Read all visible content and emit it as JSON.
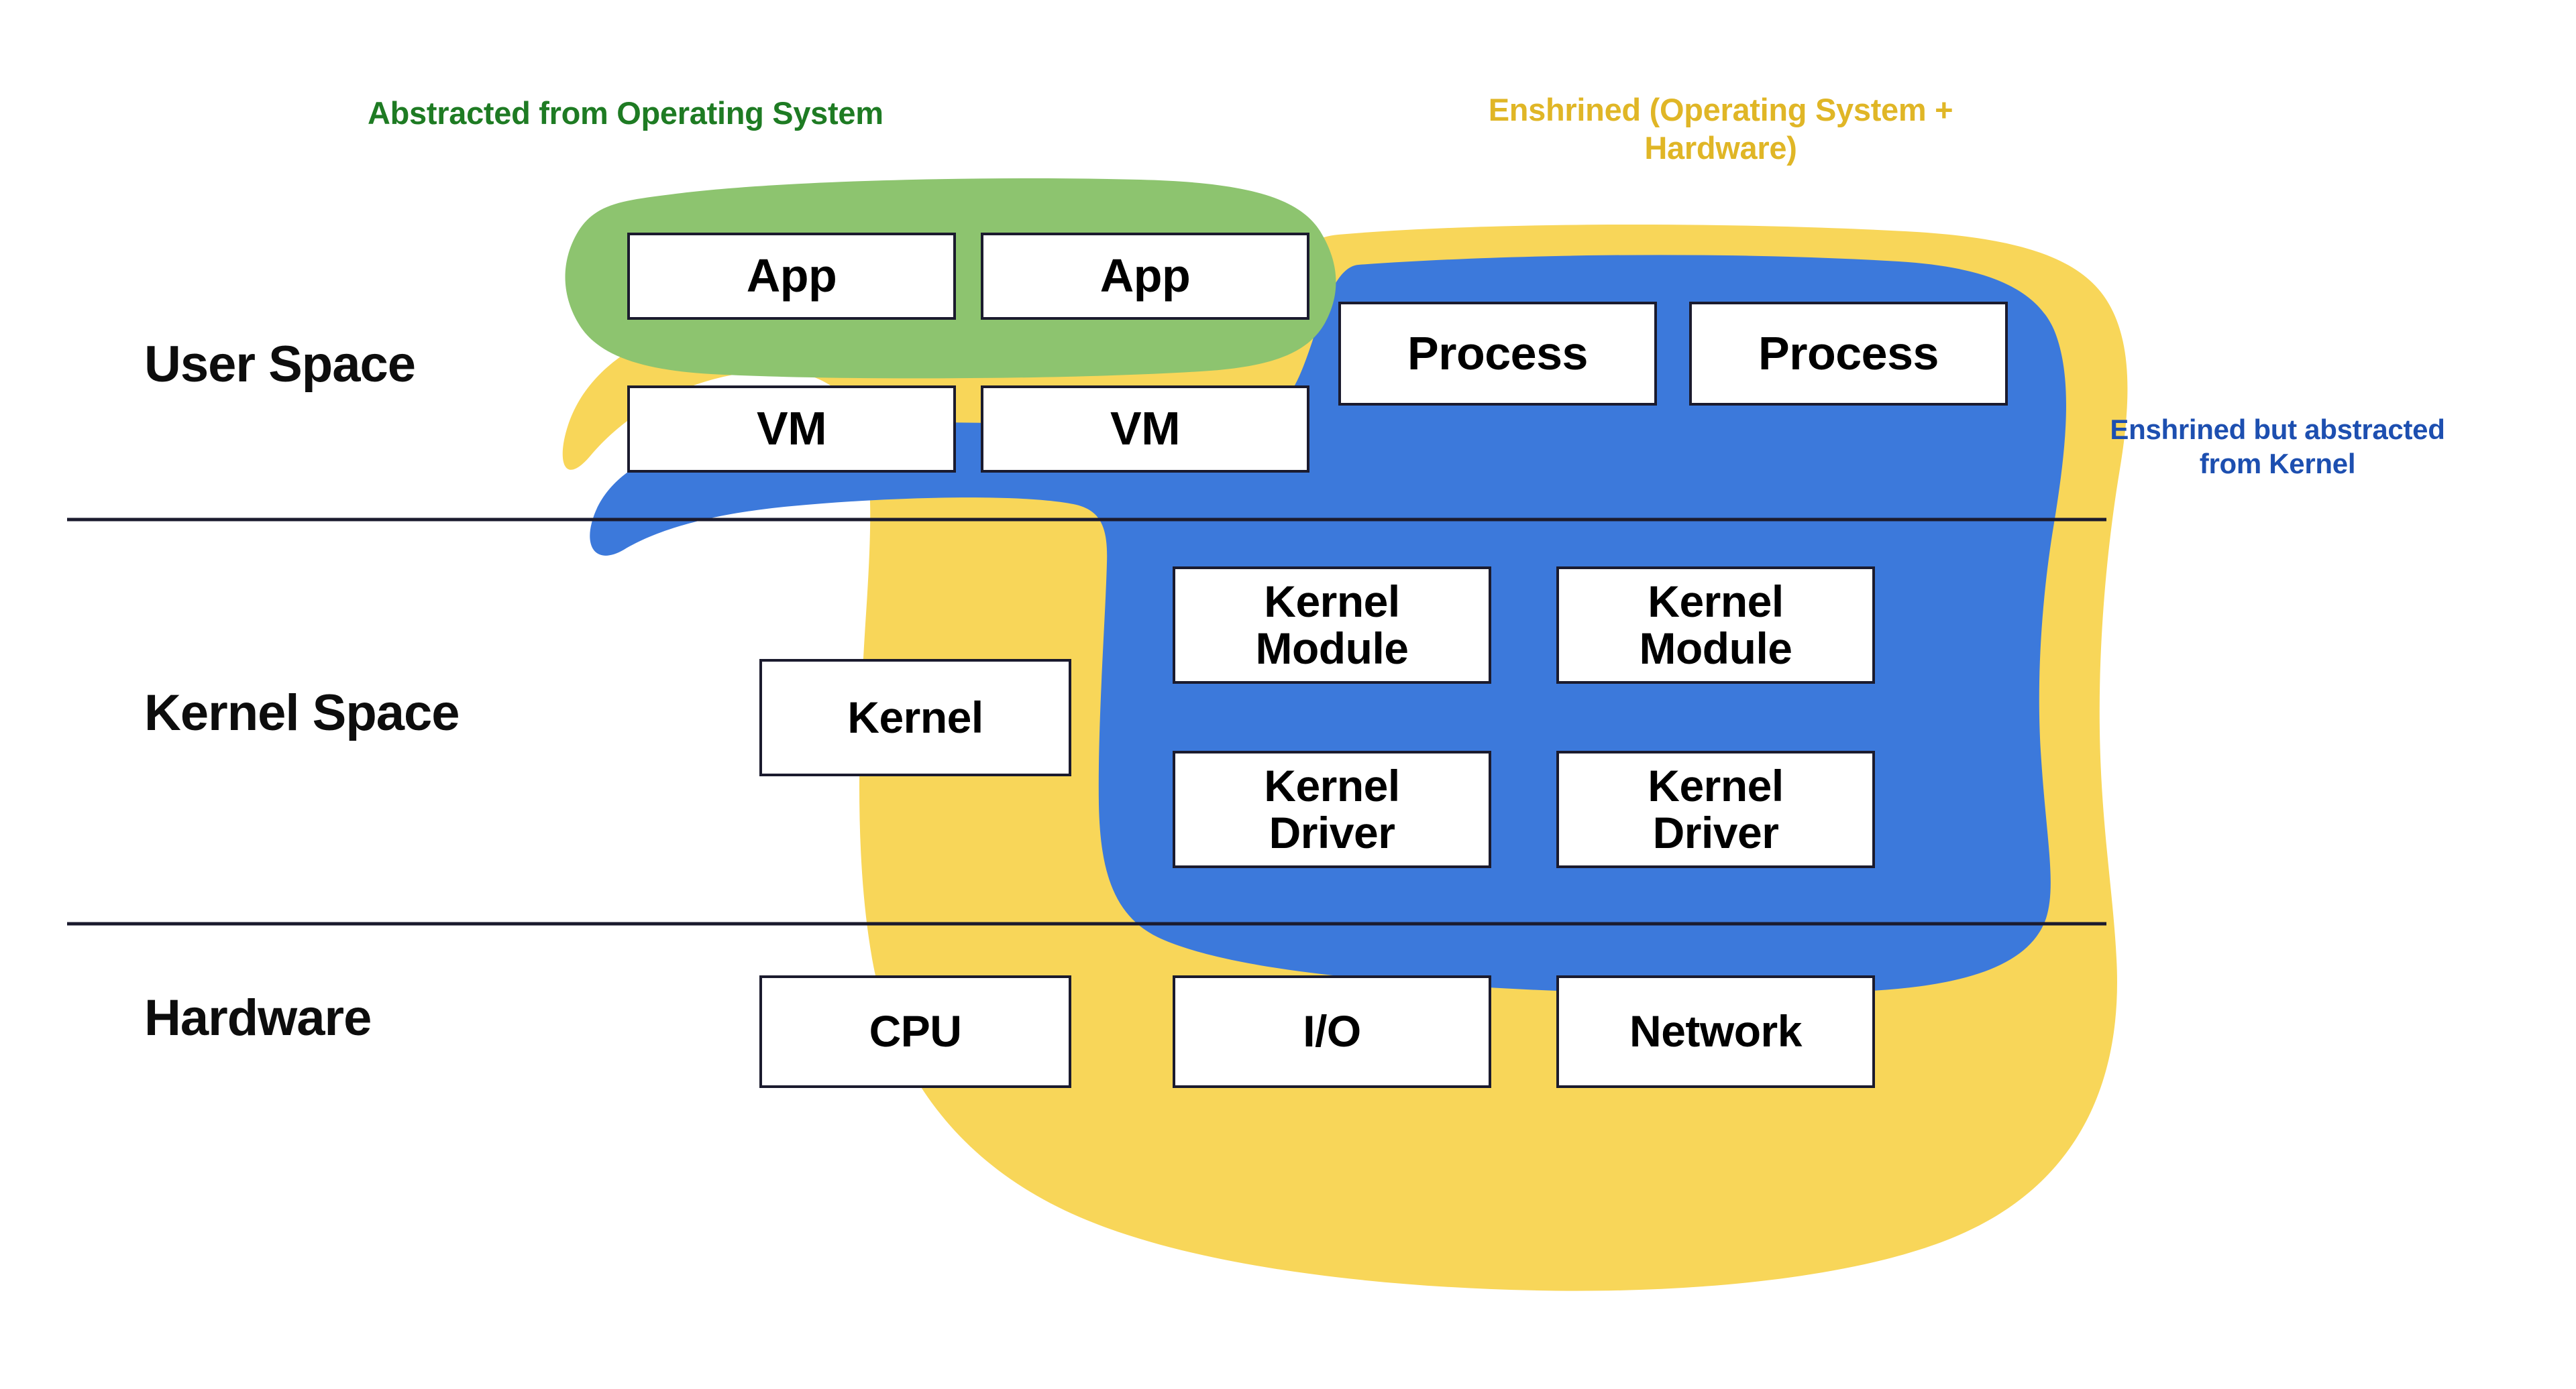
{
  "diagram": {
    "title_present": false,
    "annotations": {
      "green": "Abstracted from Operating System",
      "yellow_line1": "Enshrined (Operating System +",
      "yellow_line2": "Hardware)",
      "blue_line1": "Enshrined but abstracted",
      "blue_line2": "from Kernel"
    },
    "zones": [
      {
        "id": "user-space",
        "label": "User Space"
      },
      {
        "id": "kernel-space",
        "label": "Kernel Space"
      },
      {
        "id": "hardware",
        "label": "Hardware"
      }
    ],
    "nodes": {
      "app_1": "App",
      "app_2": "App",
      "process_1": "Process",
      "process_2": "Process",
      "vm_1": "VM",
      "vm_2": "VM",
      "kernel": "Kernel",
      "kernel_module_1": "Kernel\nModule",
      "kernel_module_2": "Kernel\nModule",
      "kernel_driver_1": "Kernel\nDriver",
      "kernel_driver_2": "Kernel\nDriver",
      "cpu": "CPU",
      "io": "I/O",
      "network": "Network"
    },
    "colors": {
      "green_blob": "#8DC46F",
      "yellow_blob": "#F8D659",
      "blue_blob": "#3C79DB",
      "green_text": "#1E7B23",
      "yellow_text": "#E0B626",
      "blue_text": "#1D4FB0",
      "node_border": "#1B1B2E",
      "node_fill": "#FFFFFF",
      "divider": "#1B1B2E",
      "background": "#FFFFFF"
    }
  }
}
